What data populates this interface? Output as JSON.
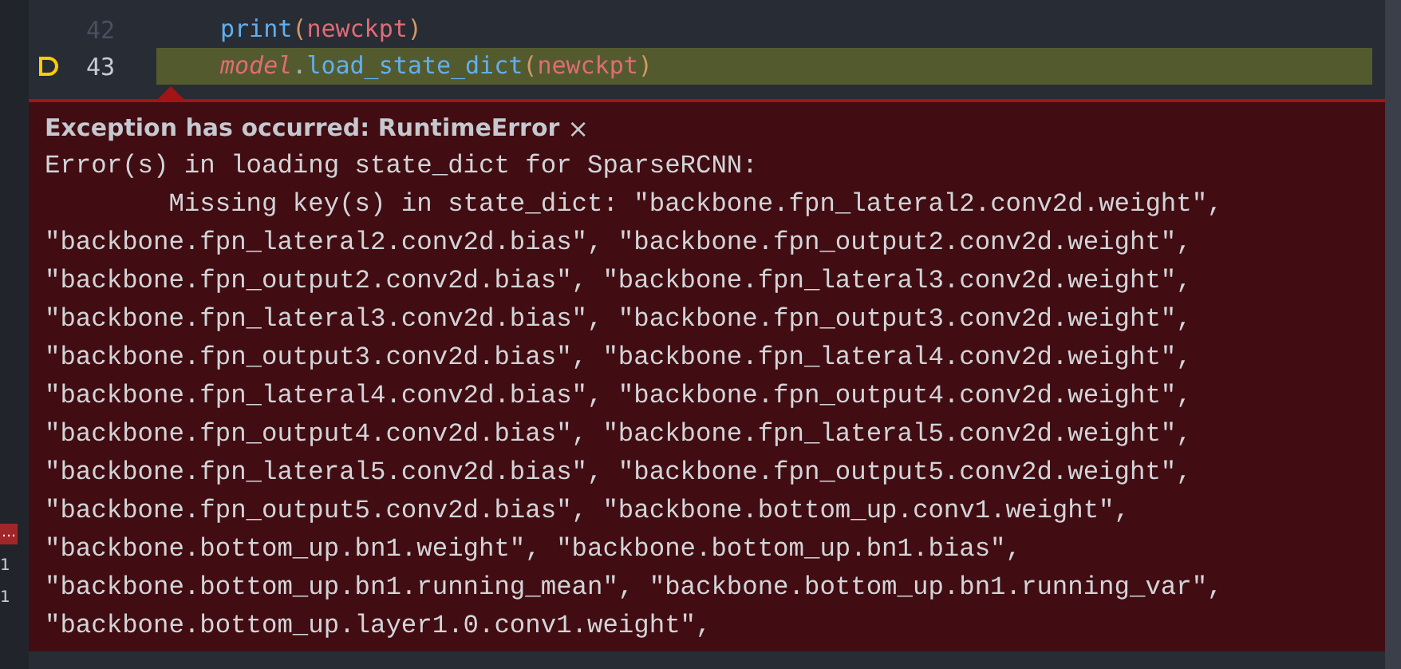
{
  "side_panel": {
    "items": [
      {
        "kind": "badge",
        "text": "…"
      },
      {
        "kind": "count",
        "text": "1"
      },
      {
        "kind": "count",
        "text": "1"
      }
    ]
  },
  "editor": {
    "lines": [
      {
        "number": "42",
        "current": false,
        "tokens": [
          {
            "kind": "function",
            "text": "print"
          },
          {
            "kind": "paren",
            "text": "("
          },
          {
            "kind": "variable",
            "text": "newckpt"
          },
          {
            "kind": "paren",
            "text": ")"
          }
        ]
      },
      {
        "number": "43",
        "current": true,
        "tokens": [
          {
            "kind": "object",
            "text": "model"
          },
          {
            "kind": "plain",
            "text": "."
          },
          {
            "kind": "function",
            "text": "load_state_dict"
          },
          {
            "kind": "paren",
            "text": "("
          },
          {
            "kind": "variable",
            "text": "newckpt"
          },
          {
            "kind": "paren",
            "text": ")"
          }
        ]
      }
    ]
  },
  "exception": {
    "title": "Exception has occurred: RuntimeError",
    "close": "×",
    "message": "Error(s) in loading state_dict for SparseRCNN:\n\tMissing key(s) in state_dict: \"backbone.fpn_lateral2.conv2d.weight\", \n\"backbone.fpn_lateral2.conv2d.bias\", \"backbone.fpn_output2.conv2d.weight\", \n\"backbone.fpn_output2.conv2d.bias\", \"backbone.fpn_lateral3.conv2d.weight\", \n\"backbone.fpn_lateral3.conv2d.bias\", \"backbone.fpn_output3.conv2d.weight\", \n\"backbone.fpn_output3.conv2d.bias\", \"backbone.fpn_lateral4.conv2d.weight\", \n\"backbone.fpn_lateral4.conv2d.bias\", \"backbone.fpn_output4.conv2d.weight\", \n\"backbone.fpn_output4.conv2d.bias\", \"backbone.fpn_lateral5.conv2d.weight\", \n\"backbone.fpn_lateral5.conv2d.bias\", \"backbone.fpn_output5.conv2d.weight\", \n\"backbone.fpn_output5.conv2d.bias\", \"backbone.bottom_up.conv1.weight\", \n\"backbone.bottom_up.bn1.weight\", \"backbone.bottom_up.bn1.bias\", \n\"backbone.bottom_up.bn1.running_mean\", \"backbone.bottom_up.bn1.running_var\", \n\"backbone.bottom_up.layer1.0.conv1.weight\","
  }
}
